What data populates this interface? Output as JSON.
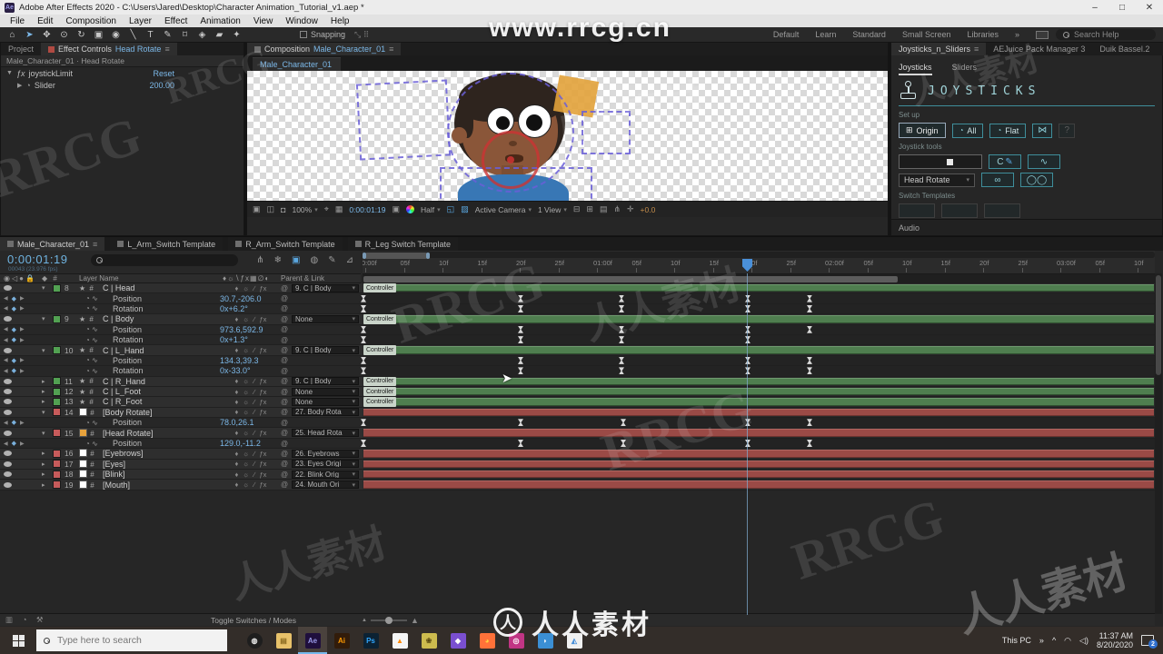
{
  "window": {
    "title": "Adobe After Effects 2020 - C:\\Users\\Jared\\Desktop\\Character Animation_Tutorial_v1.aep *",
    "app_badge": "Ae",
    "menus": [
      "File",
      "Edit",
      "Composition",
      "Layer",
      "Effect",
      "Animation",
      "View",
      "Window",
      "Help"
    ],
    "controls": {
      "minimize": "–",
      "maximize": "□",
      "close": "✕"
    }
  },
  "toolbar": {
    "tools": [
      "⌂",
      "➤",
      "✥",
      "⊙",
      "↻",
      "▣",
      "◉",
      "╲",
      "T",
      "✎",
      "⌑",
      "◈",
      "▰",
      "✦"
    ],
    "snapping_label": "Snapping",
    "workspaces": [
      "Default",
      "Learn",
      "Standard",
      "Small Screen",
      "Libraries"
    ],
    "overflow": "»",
    "search_label": "Search Help"
  },
  "left_panel": {
    "tab_project": "Project",
    "tab_effect_controls": "Effect Controls",
    "tab_effect_target": "Head Rotate",
    "breadcrumb": "Male_Character_01 · Head Rotate",
    "effect_name": "joystickLimit",
    "effect_reset": "Reset",
    "slider_name": "Slider",
    "slider_value": "200.00"
  },
  "comp_panel": {
    "tab_label": "Composition",
    "tab_comp_name": "Male_Character_01",
    "viewer_tab": "Male_Character_01",
    "zoom": "100%",
    "timecode": "0:00:01:19",
    "resolution": "Half",
    "camera": "Active Camera",
    "view_layout": "1 View",
    "exposure": "+0.0"
  },
  "right_panel": {
    "tabs": [
      "Joysticks_n_Sliders",
      "AEJuice Pack Manager 3",
      "Duik Bassel.2"
    ],
    "overflow": "»",
    "sub_tabs": [
      "Joysticks",
      "Sliders"
    ],
    "logo": "JOYSTICKS",
    "setup_label": "Set up",
    "btn_origin": "Origin",
    "btn_all": "All",
    "btn_flat": "Flat",
    "btn_help": "?",
    "tools_label": "Joystick tools",
    "joystick_dropdown": "Head Rotate",
    "templates_label": "Switch Templates",
    "audio_label": "Audio"
  },
  "timeline": {
    "tabs": [
      "Male_Character_01",
      "L_Arm_Switch Template",
      "R_Arm_Switch Template",
      "R_Leg Switch Template"
    ],
    "timecode": "0:00:01:19",
    "frame_info": "00043 (23.976 fps)",
    "columns": {
      "layer_name": "Layer Name",
      "parent": "Parent & Link"
    },
    "ruler": {
      "spacing": 42.5,
      "start": 3,
      "ticks": [
        "0:00f",
        "05f",
        "10f",
        "15f",
        "20f",
        "25f",
        "01:00f",
        "05f",
        "10f",
        "15f",
        "20f",
        "25f",
        "02:00f",
        "05f",
        "10f",
        "15f",
        "20f",
        "25f",
        "03:00f",
        "05f",
        "10f"
      ]
    },
    "controller_chip": "Controller",
    "layers": [
      {
        "index": "8",
        "name": "C | Head",
        "label_color": "#52a152",
        "bar": "green",
        "chip": true,
        "expanded": true,
        "parent": "9. C | Body",
        "props": [
          {
            "name": "Position",
            "value": "30.7,-206.0",
            "keys": [
              1,
              174,
              285,
              424,
              492
            ]
          },
          {
            "name": "Rotation",
            "value": "0x+6.2°",
            "keys": [
              1,
              174,
              285,
              424,
              492
            ]
          }
        ]
      },
      {
        "index": "9",
        "name": "C | Body",
        "label_color": "#52a152",
        "bar": "green",
        "chip": true,
        "expanded": true,
        "parent": "None",
        "props": [
          {
            "name": "Position",
            "value": "973.6,592.9",
            "keys": [
              1,
              174,
              285,
              424,
              492
            ]
          },
          {
            "name": "Rotation",
            "value": "0x+1.3°",
            "keys": [
              1,
              174,
              285,
              424
            ]
          }
        ]
      },
      {
        "index": "10",
        "name": "C | L_Hand",
        "label_color": "#52a152",
        "bar": "green",
        "chip": true,
        "expanded": true,
        "parent": "9. C | Body",
        "props": [
          {
            "name": "Position",
            "value": "134.3,39.3",
            "keys": [
              1,
              174,
              285,
              424,
              492
            ]
          },
          {
            "name": "Rotation",
            "value": "0x-33.0°",
            "keys": [
              1,
              174,
              285,
              424,
              492
            ]
          }
        ]
      },
      {
        "index": "11",
        "name": "C | R_Hand",
        "label_color": "#52a152",
        "bar": "green",
        "chip": true,
        "expanded": false,
        "parent": "9. C | Body",
        "props": []
      },
      {
        "index": "12",
        "name": "C | L_Foot",
        "label_color": "#52a152",
        "bar": "green",
        "chip": true,
        "expanded": false,
        "parent": "None",
        "props": []
      },
      {
        "index": "13",
        "name": "C | R_Foot",
        "label_color": "#52a152",
        "bar": "green",
        "chip": true,
        "expanded": false,
        "parent": "None",
        "props": []
      },
      {
        "index": "14",
        "name": "[Body Rotate]",
        "label_color": "#c75b5b",
        "fill": "#ffffff",
        "bar": "red",
        "chip": false,
        "expanded": true,
        "parent": "27. Body Rota",
        "props": [
          {
            "name": "Position",
            "value": "78.0,26.1",
            "keys": [
              1,
              174,
              287,
              424,
              492
            ]
          }
        ]
      },
      {
        "index": "15",
        "name": "[Head Rotate]",
        "label_color": "#c75b5b",
        "fill": "#e8a33c",
        "bar": "red",
        "chip": false,
        "expanded": true,
        "parent": "25. Head Rota",
        "props": [
          {
            "name": "Position",
            "value": "129.0,-11.2",
            "keys": [
              1,
              174,
              287,
              424,
              492
            ]
          }
        ]
      },
      {
        "index": "16",
        "name": "[Eyebrows]",
        "label_color": "#c75b5b",
        "fill": "#ffffff",
        "bar": "red",
        "chip": false,
        "expanded": false,
        "parent": "26. Eyebrows",
        "props": []
      },
      {
        "index": "17",
        "name": "[Eyes]",
        "label_color": "#c75b5b",
        "fill": "#ffffff",
        "bar": "red",
        "chip": false,
        "expanded": false,
        "parent": "23. Eyes Origi",
        "props": []
      },
      {
        "index": "18",
        "name": "[Blink]",
        "label_color": "#c75b5b",
        "fill": "#ffffff",
        "bar": "red",
        "chip": false,
        "expanded": false,
        "parent": "22. Blink Orig",
        "props": []
      },
      {
        "index": "19",
        "name": "[Mouth]",
        "label_color": "#c75b5b",
        "fill": "#ffffff",
        "bar": "red",
        "chip": false,
        "expanded": false,
        "parent": "24. Mouth Ori",
        "props": []
      }
    ],
    "footer": {
      "toggle_label": "Toggle Switches / Modes"
    }
  },
  "taskbar": {
    "search_placeholder": "Type here to search",
    "apps": [
      {
        "name": "cortana-icon",
        "bg": "#1e1e1e",
        "fg": "#e8e8e8",
        "glyph": "◍",
        "active": false
      },
      {
        "name": "file-explorer-icon",
        "bg": "#e8c26a",
        "fg": "#8a6a20",
        "glyph": "▤",
        "active": false
      },
      {
        "name": "after-effects-icon",
        "bg": "#1f0f3d",
        "fg": "#9a9ae8",
        "glyph": "Ae",
        "active": true
      },
      {
        "name": "illustrator-icon",
        "bg": "#321c0a",
        "fg": "#ff9a00",
        "glyph": "Ai",
        "active": false
      },
      {
        "name": "photoshop-icon",
        "bg": "#0c2233",
        "fg": "#31a8ff",
        "glyph": "Ps",
        "active": false
      },
      {
        "name": "vlc-icon",
        "bg": "#f5f5f5",
        "fg": "#ff8800",
        "glyph": "▲",
        "active": false
      },
      {
        "name": "app-icon-1",
        "bg": "#cdbb4e",
        "fg": "#5a4a10",
        "glyph": "❀",
        "active": false
      },
      {
        "name": "app-icon-2",
        "bg": "#7a4fd0",
        "fg": "#ffffff",
        "glyph": "◆",
        "active": false
      },
      {
        "name": "firefox-icon",
        "bg": "#ff7139",
        "fg": "#ffd23c",
        "glyph": "◕",
        "active": false
      },
      {
        "name": "instagram-icon",
        "bg": "#c13584",
        "fg": "#ffffff",
        "glyph": "◎",
        "active": false
      },
      {
        "name": "chat-app-icon",
        "bg": "#3b8fd4",
        "fg": "#ffffff",
        "glyph": "◗",
        "active": false
      },
      {
        "name": "photos-icon",
        "bg": "#f0f0f0",
        "fg": "#4a90d9",
        "glyph": "◭",
        "active": false
      }
    ],
    "tray": {
      "this_pc": "This PC",
      "overflow": "»",
      "chevron": "^",
      "time": "11:37 AM",
      "date": "8/20/2020",
      "badge": "2"
    }
  },
  "watermarks": {
    "url": "www.rrcg.cn",
    "brand": "RRCG",
    "cn": "人人素材",
    "logo_char": "人",
    "logo_text": "人人素材"
  }
}
